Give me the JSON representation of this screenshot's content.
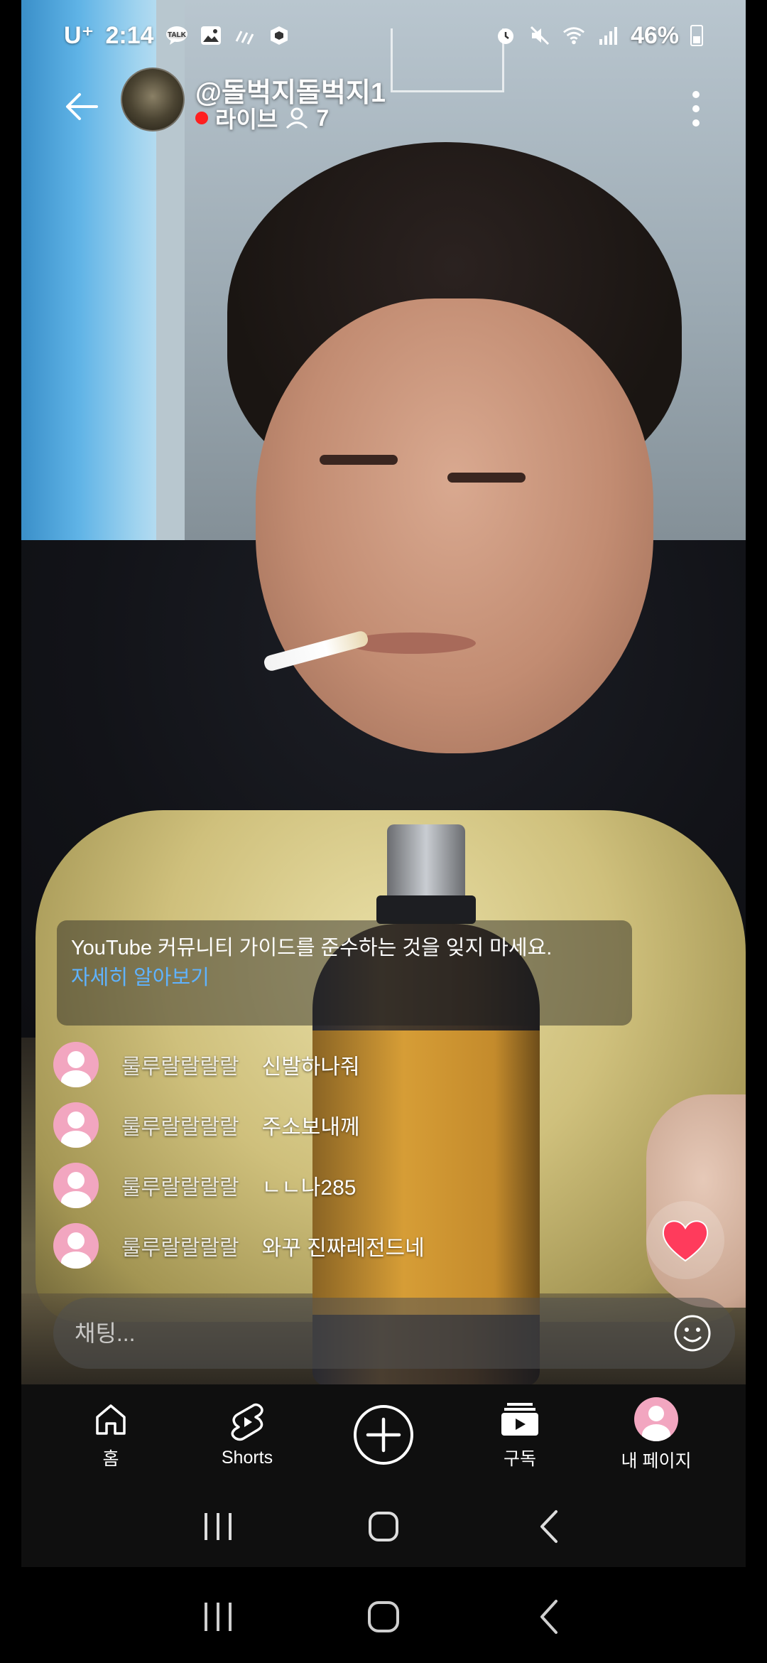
{
  "status_bar": {
    "carrier": "U⁺",
    "time": "2:14",
    "battery": "46%",
    "left_icons": [
      "kakaotalk-icon",
      "gallery-icon",
      "signal-sync-icon",
      "app-cube-icon"
    ],
    "right_icons": [
      "alarm-icon",
      "mute-icon",
      "wifi-icon",
      "cell-signal-icon",
      "battery-icon"
    ]
  },
  "header": {
    "channel_name": "@돌벅지돌벅지1",
    "live_label": "라이브",
    "viewer_count": "7",
    "live_color": "#ff1f1f"
  },
  "guideline": {
    "text": "YouTube 커뮤니티 가이드를 준수하는 것을 잊지 마세요.",
    "link": "자세히 알아보기",
    "link_color": "#5fb3ff"
  },
  "chat": {
    "messages": [
      {
        "user": "룰루랄랄랄랄",
        "message": "신발하나줘"
      },
      {
        "user": "룰루랄랄랄랄",
        "message": "주소보내께"
      },
      {
        "user": "룰루랄랄랄랄",
        "message": "ㄴㄴ나285"
      },
      {
        "user": "룰루랄랄랄랄",
        "message": "와꾸 진짜레전드네"
      }
    ],
    "input_placeholder": "채팅...",
    "heart_color": "#ff3b5c"
  },
  "bottom_nav": {
    "items": [
      {
        "label": "홈",
        "icon": "home-icon"
      },
      {
        "label": "Shorts",
        "icon": "shorts-icon"
      },
      {
        "label": "",
        "icon": "create-plus-icon"
      },
      {
        "label": "구독",
        "icon": "subscriptions-icon"
      },
      {
        "label": "내 페이지",
        "icon": "profile-avatar-icon"
      }
    ]
  },
  "system_nav": {
    "buttons": [
      "recents-icon",
      "home-button-icon",
      "back-nav-icon"
    ]
  },
  "colors": {
    "avatar_pink": "#f2a6c0",
    "nav_background": "#0f0f0f"
  }
}
